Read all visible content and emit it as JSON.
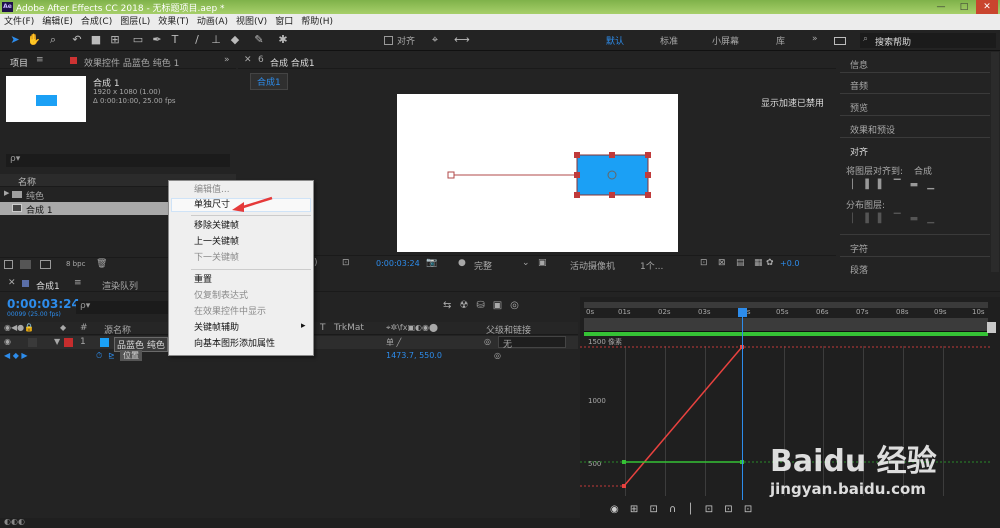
{
  "titlebar": {
    "app_logo": "Ae",
    "title": "Adobe After Effects CC 2018 - 无标题项目.aep *",
    "min": "—",
    "max": "□",
    "close": "✕"
  },
  "menu": [
    "文件(F)",
    "编辑(E)",
    "合成(C)",
    "图层(L)",
    "效果(T)",
    "动画(A)",
    "视图(V)",
    "窗口",
    "帮助(H)"
  ],
  "toolbar": {
    "snap_label": "对齐",
    "workspaces": [
      "默认",
      "标准",
      "小屏幕",
      "库"
    ],
    "more": "»",
    "search_placeholder": "搜索帮助"
  },
  "project_panel": {
    "tab_label": "项目",
    "effects_tab": "效果控件 品蓝色 纯色 1",
    "comp_name": "合成 1",
    "comp_info_1": "1920 x 1080 (1.00)",
    "comp_info_2": "Δ 0:00:10:00, 25.00 fps",
    "col_name": "名称",
    "items": [
      "纯色",
      "合成 1"
    ],
    "bpc": "8 bpc"
  },
  "composition_panel": {
    "tab_label": "合成 合成1",
    "breadcrumb": "合成1",
    "gpu_note": "显示加速已禁用",
    "timecode": "0:00:03:24",
    "quality": "完整",
    "camera": "活动摄像机",
    "views": "1个...",
    "offset": "+0.0"
  },
  "context_menu": {
    "items": [
      {
        "label": "编辑值...",
        "enabled": false
      },
      {
        "label": "单独尺寸",
        "enabled": true,
        "highlighted": true
      },
      {
        "label": "移除关键帧",
        "enabled": true
      },
      {
        "label": "上一关键帧",
        "enabled": true
      },
      {
        "label": "下一关键帧",
        "enabled": false
      },
      {
        "label": "重置",
        "enabled": true
      },
      {
        "label": "仅复制表达式",
        "enabled": false
      },
      {
        "label": "在效果控件中显示",
        "enabled": false
      },
      {
        "label": "关键帧辅助",
        "enabled": true,
        "submenu": "▸"
      },
      {
        "label": "向基本图形添加属性",
        "enabled": true
      }
    ]
  },
  "right_panel": {
    "items": [
      "信息",
      "音频",
      "预览",
      "效果和预设",
      "对齐",
      "将图层对齐到:",
      "合成",
      "分布图层:",
      "字符",
      "段落"
    ]
  },
  "timeline": {
    "comp_tab": "合成1",
    "render_tab": "渲染队列",
    "timecode": "0:00:03:24",
    "sub_timecode": "00099 (25.00 fps)",
    "search_placeholder": "ρ▾",
    "col_num": "#",
    "col_source": "源名称",
    "col_t": "T",
    "col_trkmat": "TrkMat",
    "col_parent": "父级和链接",
    "layer_index": "1",
    "layer_name": "品蓝色 纯色",
    "parent_value": "无",
    "property_name": "位置",
    "property_value": "1473.7, 550.0",
    "ruler": [
      "0s",
      "01s",
      "02s",
      "03s",
      "04s",
      "05s",
      "06s",
      "07s",
      "08s",
      "09s",
      "10s"
    ],
    "graph_labels": [
      "1500 像素",
      "1000",
      "500"
    ]
  },
  "watermark": {
    "brand": "Baidu 经验",
    "url": "jingyan.baidu.com"
  },
  "colors": {
    "accent": "#2d8ceb",
    "solid": "#1ba0f5",
    "graph_red": "#e8423f",
    "graph_green": "#35c235",
    "arrow": "#e53a3a"
  }
}
